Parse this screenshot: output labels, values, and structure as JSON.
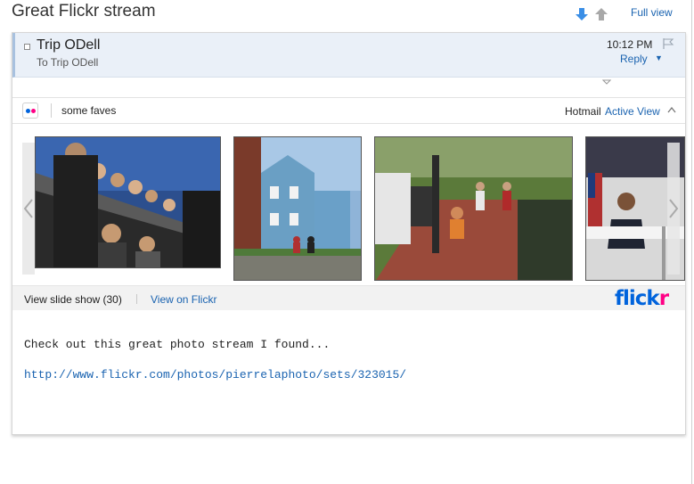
{
  "page": {
    "title": "Great Flickr stream"
  },
  "toolbar": {
    "full_view_label": "Full view",
    "next_icon": "arrow-down-icon",
    "prev_icon": "arrow-up-icon"
  },
  "message": {
    "sender": "Trip ODell",
    "to_line": "To Trip ODell",
    "time": "10:12 PM",
    "reply_label": "Reply",
    "reply_caret": "▼"
  },
  "embed": {
    "title": "some faves",
    "provider": "Hotmail",
    "active_view_label": "Active View",
    "slideshow_label": "View slide show (30)",
    "view_on_label": "View on Flickr",
    "logo_part1": "flick",
    "logo_part2": "r",
    "colors": {
      "flickr_blue": "#0063dc",
      "flickr_pink": "#ff0084",
      "link": "#1a63b0"
    }
  },
  "body": {
    "text": "Check out this great photo stream I found...",
    "link": "http://www.flickr.com/photos/pierrelaphoto/sets/323015/"
  }
}
